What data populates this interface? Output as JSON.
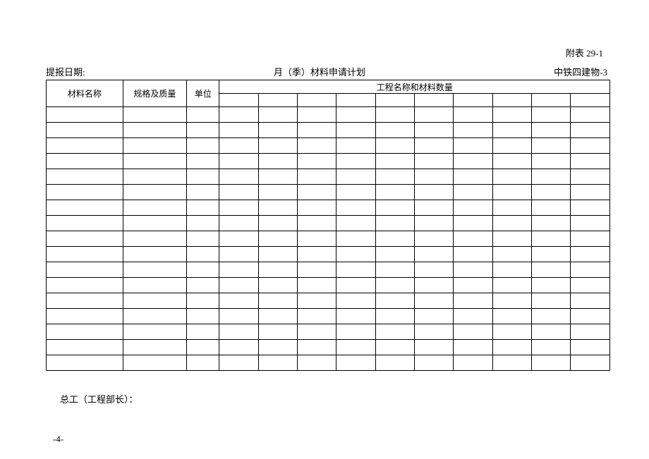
{
  "attachment_label": "附表 29-1",
  "header": {
    "report_date_label": "提报日期:",
    "center_title": "月（季）材料申请计划",
    "org_label": "中铁四建物-3"
  },
  "table": {
    "col_material_name": "材料名称",
    "col_spec_quality": "规格及质量",
    "col_unit": "单位",
    "col_project_qty": "工程名称和材料数量",
    "body_rows": 17,
    "qty_sub_cols": 10
  },
  "footer": {
    "chief_engineer_label": "总工（工程部长）："
  },
  "page_number": "-4-"
}
